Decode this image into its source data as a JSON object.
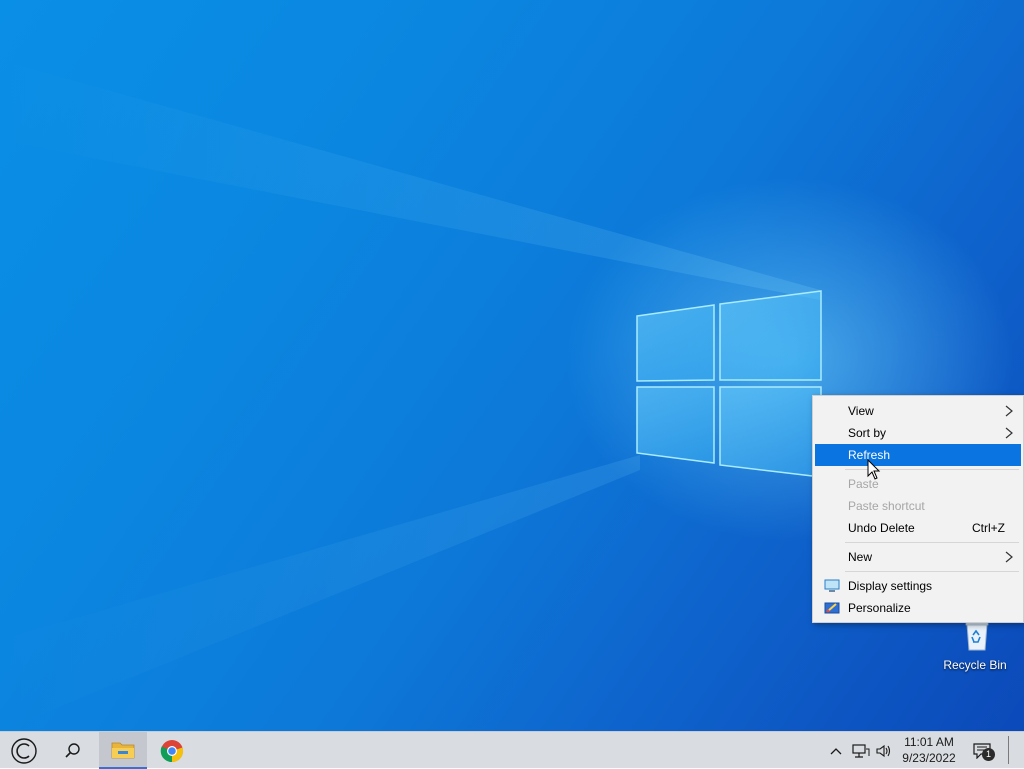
{
  "desktop": {
    "wallpaper": "windows-10-light-blue",
    "colors": {
      "sky": "#0b86e0",
      "deep": "#0b49b9",
      "glow": "#78dcff"
    },
    "icons": [
      {
        "label": "Recycle Bin",
        "icon": "recycle-bin-icon"
      }
    ]
  },
  "context_menu": {
    "items": [
      {
        "label": "View",
        "submenu": true
      },
      {
        "label": "Sort by",
        "submenu": true
      },
      {
        "label": "Refresh",
        "highlighted": true
      },
      {
        "label": "Paste",
        "disabled": true
      },
      {
        "label": "Paste shortcut",
        "disabled": true
      },
      {
        "label": "Undo Delete",
        "shortcut": "Ctrl+Z"
      },
      {
        "label": "New",
        "submenu": true
      },
      {
        "label": "Display settings",
        "icon": "display-icon"
      },
      {
        "label": "Personalize",
        "icon": "personalize-icon"
      }
    ],
    "highlight_color": "#0a74e0"
  },
  "taskbar": {
    "start_icon": "start-circle-icon",
    "search_icon": "search-icon",
    "pinned": [
      {
        "name": "File Explorer",
        "icon": "folder-icon",
        "active": true
      },
      {
        "name": "Google Chrome",
        "icon": "chrome-icon",
        "active": false
      }
    ],
    "tray": {
      "icons": [
        "chevron-up-icon",
        "network-icon",
        "volume-icon"
      ],
      "time": "11:01 AM",
      "date": "9/23/2022",
      "notification_count": "1"
    }
  }
}
